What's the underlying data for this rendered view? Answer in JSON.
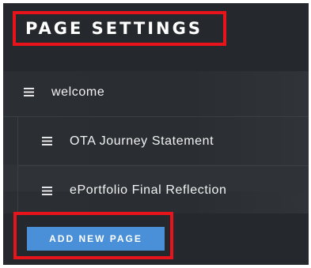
{
  "panel": {
    "title": "PAGE SETTINGS",
    "pages": [
      {
        "label": "welcome",
        "icon": "hamburger-icon",
        "level": 0
      },
      {
        "label": "OTA Journey Statement",
        "icon": "hamburger-icon",
        "level": 1
      },
      {
        "label": "ePortfolio Final Reflection",
        "icon": "hamburger-icon",
        "level": 1
      }
    ],
    "add_button_label": "ADD NEW PAGE"
  },
  "colors": {
    "panel_bg": "#25292d",
    "highlight_border": "#e8141b",
    "button_bg": "#4a90d9",
    "text": "#f2f2f2"
  }
}
